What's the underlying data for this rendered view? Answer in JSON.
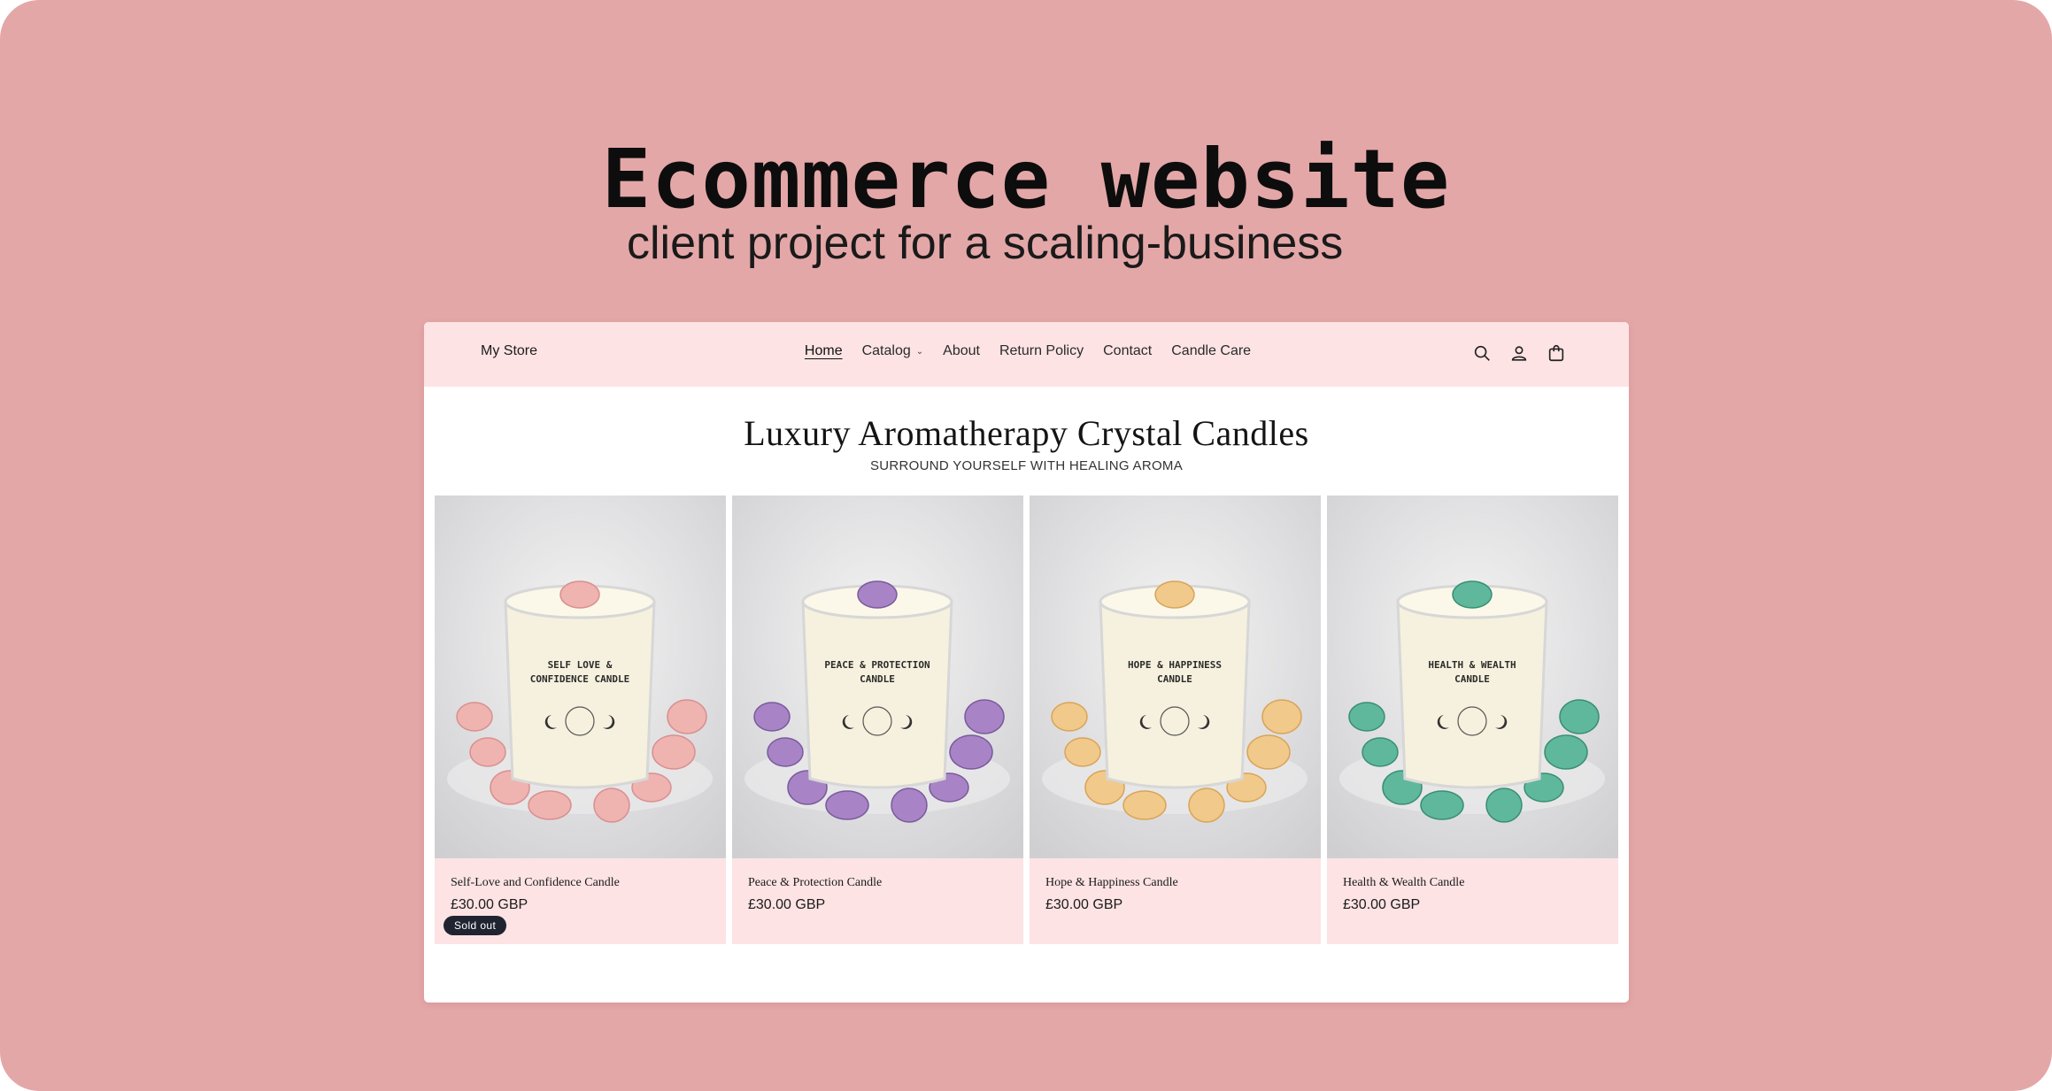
{
  "hero": {
    "title": "Ecommerce website",
    "subtitle": "client project for a scaling-business"
  },
  "header": {
    "store_name": "My Store",
    "nav": [
      {
        "label": "Home",
        "active": true
      },
      {
        "label": "Catalog",
        "has_dropdown": true
      },
      {
        "label": "About"
      },
      {
        "label": "Return Policy"
      },
      {
        "label": "Contact"
      },
      {
        "label": "Candle Care"
      }
    ],
    "icons": [
      "search-icon",
      "account-icon",
      "cart-icon"
    ]
  },
  "collection": {
    "title": "Luxury Aromatherapy Crystal Candles",
    "subtitle": "SURROUND YOURSELF WITH HEALING AROMA"
  },
  "products": [
    {
      "name": "Self-Love and Confidence Candle",
      "price": "£30.00 GBP",
      "badge": "Sold out",
      "label_lines": [
        "SELF LOVE &",
        "CONFIDENCE CANDLE"
      ],
      "crystal": "#efb3b0",
      "crystal_dark": "#d98f8f"
    },
    {
      "name": "Peace & Protection Candle",
      "price": "£30.00 GBP",
      "badge": null,
      "label_lines": [
        "PEACE & PROTECTION",
        "CANDLE"
      ],
      "crystal": "#a884c6",
      "crystal_dark": "#7a5a9c"
    },
    {
      "name": "Hope & Happiness Candle",
      "price": "£30.00 GBP",
      "badge": null,
      "label_lines": [
        "HOPE & HAPPINESS",
        "CANDLE"
      ],
      "crystal": "#f1c98a",
      "crystal_dark": "#d8a458"
    },
    {
      "name": "Health & Wealth Candle",
      "price": "£30.00 GBP",
      "badge": null,
      "label_lines": [
        "HEALTH & WEALTH",
        "CANDLE"
      ],
      "crystal": "#5fb89b",
      "crystal_dark": "#3a8e72"
    }
  ],
  "colors": {
    "backdrop": "#e4a7a8",
    "header_bg": "#fde3e4",
    "badge_bg": "#1f2430"
  }
}
